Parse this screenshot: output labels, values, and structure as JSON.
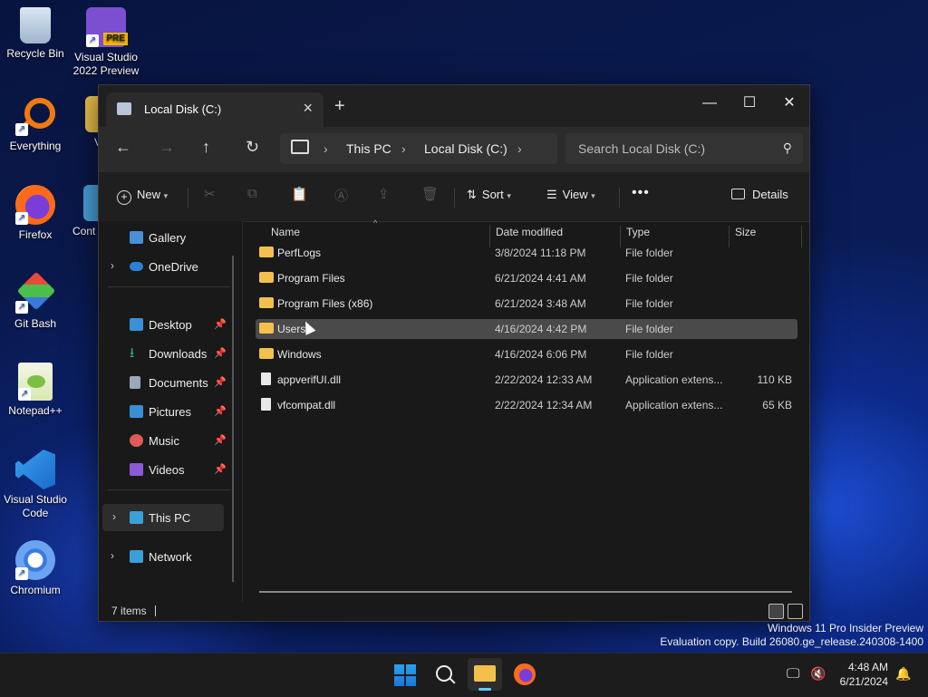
{
  "desktop": {
    "icons": [
      {
        "label": "Recycle Bin",
        "name": "recycle-bin"
      },
      {
        "label": "Visual Studio\n2022 Preview",
        "name": "visual-studio-preview",
        "badge": "PRE"
      },
      {
        "label": "Everything",
        "name": "everything"
      },
      {
        "label": "Firefox",
        "name": "firefox"
      },
      {
        "label": "Git Bash",
        "name": "git-bash"
      },
      {
        "label": "Notepad++",
        "name": "notepad-plus-plus"
      },
      {
        "label": "Visual Studio\nCode",
        "name": "vscode"
      },
      {
        "label": "Chromium",
        "name": "chromium"
      },
      {
        "label": "V",
        "name": "partial-folder"
      },
      {
        "label": "Cont",
        "name": "partial-control-panel"
      }
    ]
  },
  "window": {
    "tab_title": "Local Disk (C:)",
    "new_tab": "+",
    "minimize": "—",
    "maximize": "☐",
    "close": "✕",
    "breadcrumbs": [
      "This PC",
      "Local Disk (C:)"
    ],
    "search_placeholder": "Search Local Disk (C:)",
    "commands": {
      "new": "New",
      "sort": "Sort",
      "view": "View",
      "more": "•••",
      "details": "Details"
    },
    "sidebar": [
      {
        "label": "Gallery",
        "icon_color": "#4a90d9"
      },
      {
        "label": "OneDrive",
        "icon_color": "#2b7fd6"
      },
      {
        "label": "Desktop",
        "icon_color": "#3b8fd4"
      },
      {
        "label": "Downloads",
        "icon_color": "#2fb36a"
      },
      {
        "label": "Documents",
        "icon_color": "#9aa8b8"
      },
      {
        "label": "Pictures",
        "icon_color": "#3a8ed6"
      },
      {
        "label": "Music",
        "icon_color": "#e05a5a"
      },
      {
        "label": "Videos",
        "icon_color": "#8b5ad6"
      },
      {
        "label": "This PC",
        "icon_color": "#3ba0d8"
      },
      {
        "label": "Network",
        "icon_color": "#3ba0d8"
      }
    ],
    "columns": {
      "name": "Name",
      "date": "Date modified",
      "type": "Type",
      "size": "Size"
    },
    "files": [
      {
        "name": "PerfLogs",
        "date": "3/8/2024 11:18 PM",
        "type": "File folder",
        "size": "",
        "kind": "folder"
      },
      {
        "name": "Program Files",
        "date": "6/21/2024 4:41 AM",
        "type": "File folder",
        "size": "",
        "kind": "folder"
      },
      {
        "name": "Program Files (x86)",
        "date": "6/21/2024 3:48 AM",
        "type": "File folder",
        "size": "",
        "kind": "folder"
      },
      {
        "name": "Users",
        "date": "4/16/2024 4:42 PM",
        "type": "File folder",
        "size": "",
        "kind": "folder"
      },
      {
        "name": "Windows",
        "date": "4/16/2024 6:06 PM",
        "type": "File folder",
        "size": "",
        "kind": "folder"
      },
      {
        "name": "appverifUI.dll",
        "date": "2/22/2024 12:33 AM",
        "type": "Application extens...",
        "size": "110 KB",
        "kind": "dll"
      },
      {
        "name": "vfcompat.dll",
        "date": "2/22/2024 12:34 AM",
        "type": "Application extens...",
        "size": "65 KB",
        "kind": "dll"
      }
    ],
    "status_items": "7 items"
  },
  "watermark": {
    "line1": "Windows 11 Pro Insider Preview",
    "line2": "Evaluation copy. Build 26080.ge_release.240308-1400"
  },
  "tray": {
    "time": "4:48 AM",
    "date": "6/21/2024"
  }
}
